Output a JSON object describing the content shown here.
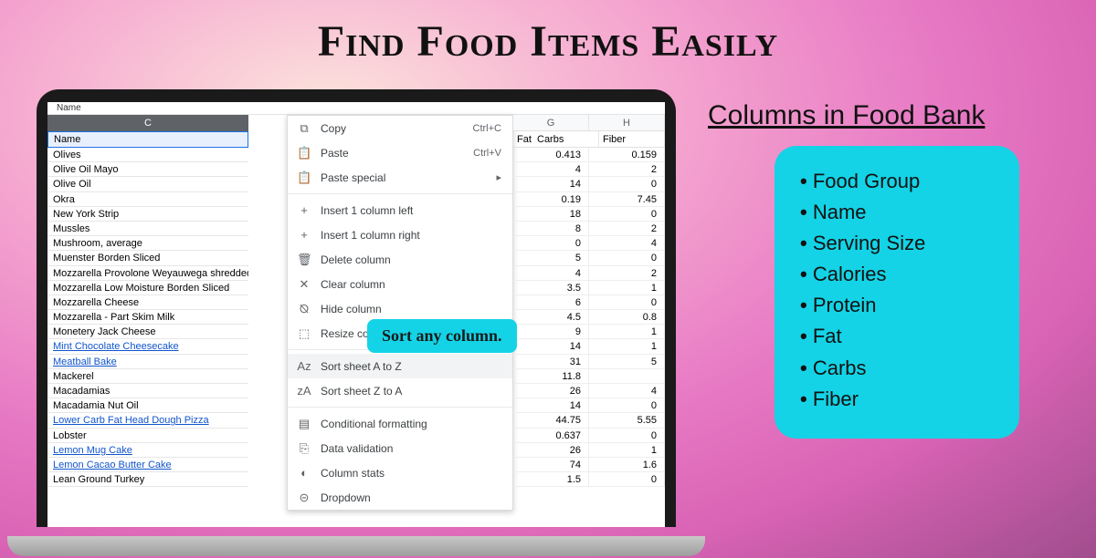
{
  "headline": "Find Food Items Easily",
  "topbit_label": "Name",
  "col_letter": "C",
  "name_header": "Name",
  "callout": "Sort any column.",
  "foods": [
    {
      "name": "Olives",
      "link": false
    },
    {
      "name": "Olive Oil Mayo",
      "link": false
    },
    {
      "name": "Olive Oil",
      "link": false
    },
    {
      "name": "Okra",
      "link": false
    },
    {
      "name": "New York Strip",
      "link": false
    },
    {
      "name": "Mussles",
      "link": false
    },
    {
      "name": "Mushroom, average",
      "link": false
    },
    {
      "name": "Muenster Borden Sliced",
      "link": false
    },
    {
      "name": "Mozzarella Provolone Weyauwega shredded",
      "link": false
    },
    {
      "name": "Mozzarella Low Moisture Borden Sliced",
      "link": false
    },
    {
      "name": "Mozzarella Cheese",
      "link": false
    },
    {
      "name": "Mozzarella - Part Skim Milk",
      "link": false
    },
    {
      "name": "Monetery Jack Cheese",
      "link": false
    },
    {
      "name": "Mint Chocolate Cheesecake",
      "link": true
    },
    {
      "name": "Meatball Bake",
      "link": true
    },
    {
      "name": "Mackerel",
      "link": false
    },
    {
      "name": "Macadamias",
      "link": false
    },
    {
      "name": "Macadamia Nut Oil",
      "link": false
    },
    {
      "name": "Lower Carb Fat Head Dough Pizza",
      "link": true
    },
    {
      "name": "Lobster",
      "link": false
    },
    {
      "name": "Lemon Mug Cake",
      "link": true
    },
    {
      "name": "Lemon Cacao Butter Cake",
      "link": true
    },
    {
      "name": "Lean Ground Turkey",
      "link": false
    }
  ],
  "ctx": [
    {
      "icon": "⧉",
      "label": "Copy",
      "shortcut": "Ctrl+C"
    },
    {
      "icon": "📋",
      "label": "Paste",
      "shortcut": "Ctrl+V"
    },
    {
      "icon": "📋",
      "label": "Paste special",
      "shortcut": "▸"
    },
    {
      "sep": true
    },
    {
      "icon": "+",
      "label": "Insert 1 column left"
    },
    {
      "icon": "+",
      "label": "Insert 1 column right"
    },
    {
      "icon": "🗑",
      "label": "Delete column"
    },
    {
      "icon": "✕",
      "label": "Clear column"
    },
    {
      "icon": "⦰",
      "label": "Hide column"
    },
    {
      "icon": "⬚",
      "label": "Resize column"
    },
    {
      "sep": true
    },
    {
      "icon": "Aᴢ",
      "label": "Sort sheet A to Z",
      "hover": true
    },
    {
      "icon": "ᴢA",
      "label": "Sort sheet Z to A"
    },
    {
      "sep": true
    },
    {
      "icon": "▤",
      "label": "Conditional formatting"
    },
    {
      "icon": "⎘",
      "label": "Data validation"
    },
    {
      "icon": "◐",
      "label": "Column stats"
    },
    {
      "icon": "⊝",
      "label": "Dropdown"
    }
  ],
  "num_letters": [
    "G",
    "H"
  ],
  "num_labels": [
    "Fat",
    "Carbs",
    "Fiber"
  ],
  "num_rows": [
    [
      "0.413",
      "0.159"
    ],
    [
      "4",
      "2"
    ],
    [
      "14",
      "0"
    ],
    [
      "0.19",
      "7.45"
    ],
    [
      "18",
      "0"
    ],
    [
      "8",
      "2"
    ],
    [
      "0",
      "4"
    ],
    [
      "5",
      "0"
    ],
    [
      "4",
      "2"
    ],
    [
      "3.5",
      "1"
    ],
    [
      "6",
      "0"
    ],
    [
      "4.5",
      "0.8"
    ],
    [
      "9",
      "1"
    ],
    [
      "14",
      "1"
    ],
    [
      "31",
      "5"
    ],
    [
      "11.8",
      ""
    ],
    [
      "26",
      "4"
    ],
    [
      "14",
      "0"
    ],
    [
      "44.75",
      "5.55"
    ],
    [
      "0.637",
      "0"
    ],
    [
      "26",
      "1"
    ],
    [
      "74",
      "1.6"
    ],
    [
      "1.5",
      "0"
    ]
  ],
  "right_title": "Columns in Food Bank",
  "columns_card": [
    "Food Group",
    "Name",
    "Serving Size",
    "Calories",
    "Protein",
    "Fat",
    "Carbs",
    "Fiber"
  ]
}
